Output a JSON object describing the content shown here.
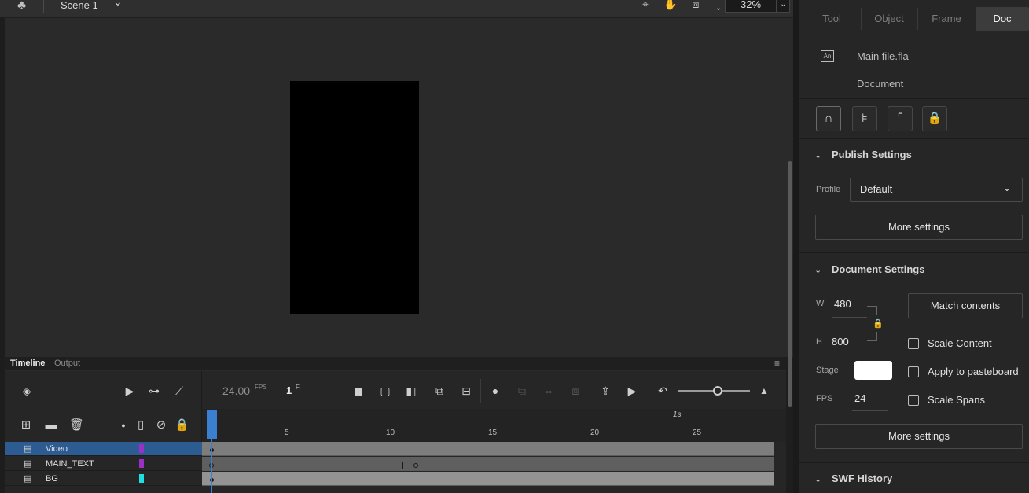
{
  "scene_bar": {
    "scene_name": "Scene 1",
    "zoom": "32%",
    "icons": [
      "club-icon",
      "chevron-down-icon",
      "snap-icon",
      "hand-icon",
      "clip-icon",
      "up-down-icon",
      "chevron-down-icon"
    ]
  },
  "stage": {
    "canvas_color": "#000000",
    "background_color": "#2a2a2a"
  },
  "timeline": {
    "tabs": [
      {
        "label": "Timeline",
        "active": true
      },
      {
        "label": "Output",
        "active": false
      }
    ],
    "fps": "24.00",
    "fps_unit": "FPS",
    "current_frame": "1",
    "frame_unit": "F",
    "ruler_ticks": [
      "5",
      "10",
      "15",
      "20",
      "25"
    ],
    "ruler_second_label": "1s",
    "layers": [
      {
        "name": "Video",
        "color": "#9b30c8",
        "selected": true
      },
      {
        "name": "MAIN_TEXT",
        "color": "#9b30c8",
        "selected": false
      },
      {
        "name": "BG",
        "color": "#1fe0e0",
        "selected": false
      }
    ]
  },
  "properties": {
    "tabs": [
      {
        "label": "Tool",
        "active": false
      },
      {
        "label": "Object",
        "active": false
      },
      {
        "label": "Frame",
        "active": false
      },
      {
        "label": "Doc",
        "active": true
      }
    ],
    "doc_badge": "An",
    "doc_name": "Main file.fla",
    "doc_type": "Document",
    "publish": {
      "title": "Publish Settings",
      "profile_label": "Profile",
      "profile_value": "Default",
      "more_settings": "More settings"
    },
    "document": {
      "title": "Document Settings",
      "w_label": "W",
      "w_value": "480",
      "h_label": "H",
      "h_value": "800",
      "match_contents": "Match contents",
      "scale_content": "Scale Content",
      "apply_pasteboard": "Apply to pasteboard",
      "scale_spans": "Scale Spans",
      "stage_label": "Stage",
      "stage_color": "#ffffff",
      "fps_label": "FPS",
      "fps_value": "24",
      "more_settings": "More settings"
    },
    "swf_history": {
      "title": "SWF History"
    }
  }
}
